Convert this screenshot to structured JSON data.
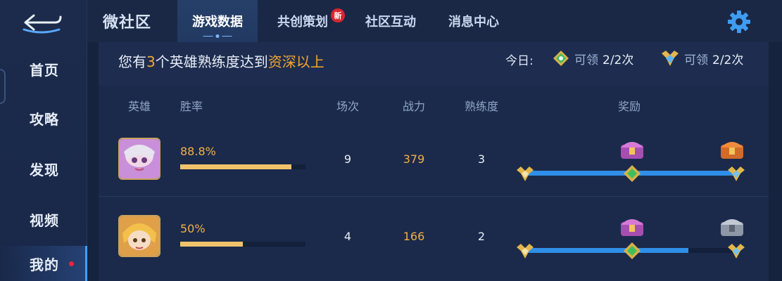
{
  "sidebar": {
    "back_icon": "back-arrow-icon",
    "items": [
      {
        "label": "首页"
      },
      {
        "label": "攻略"
      },
      {
        "label": "发现"
      },
      {
        "label": "视频"
      },
      {
        "label": "我的",
        "active": true,
        "has_dot": true
      }
    ]
  },
  "header": {
    "brand": "微社区",
    "tabs": [
      {
        "label": "游戏数据",
        "active": true
      },
      {
        "label": "共创策划",
        "badge": "新"
      },
      {
        "label": "社区互动"
      },
      {
        "label": "消息中心"
      }
    ],
    "settings_icon": "gear-icon"
  },
  "summary": {
    "prefix": "您有",
    "count": "3",
    "middle": "个英雄熟练度达到",
    "level": "资深以上",
    "today_label": "今日:",
    "rewards": [
      {
        "icon": "green-medal-icon",
        "claim": "可领",
        "count": "2/2次"
      },
      {
        "icon": "gold-medal-icon",
        "claim": "可领",
        "count": "2/2次"
      }
    ]
  },
  "table": {
    "headers": {
      "hero": "英雄",
      "winrate": "胜率",
      "matches": "场次",
      "power": "战力",
      "proficiency": "熟练度",
      "reward": "奖励"
    },
    "rows": [
      {
        "winrate": "88.8%",
        "winrate_fraction": 0.888,
        "matches": "9",
        "power": "379",
        "proficiency": "3",
        "reward_progress": 1.0
      },
      {
        "winrate": "50%",
        "winrate_fraction": 0.5,
        "matches": "4",
        "power": "166",
        "proficiency": "2",
        "reward_progress": 0.78
      }
    ]
  },
  "colors": {
    "accent": "#3da0ff",
    "highlight": "#f3a62d",
    "bar": "#f0c36a",
    "track": "#2f8fe8",
    "badge": "#d8262e"
  }
}
